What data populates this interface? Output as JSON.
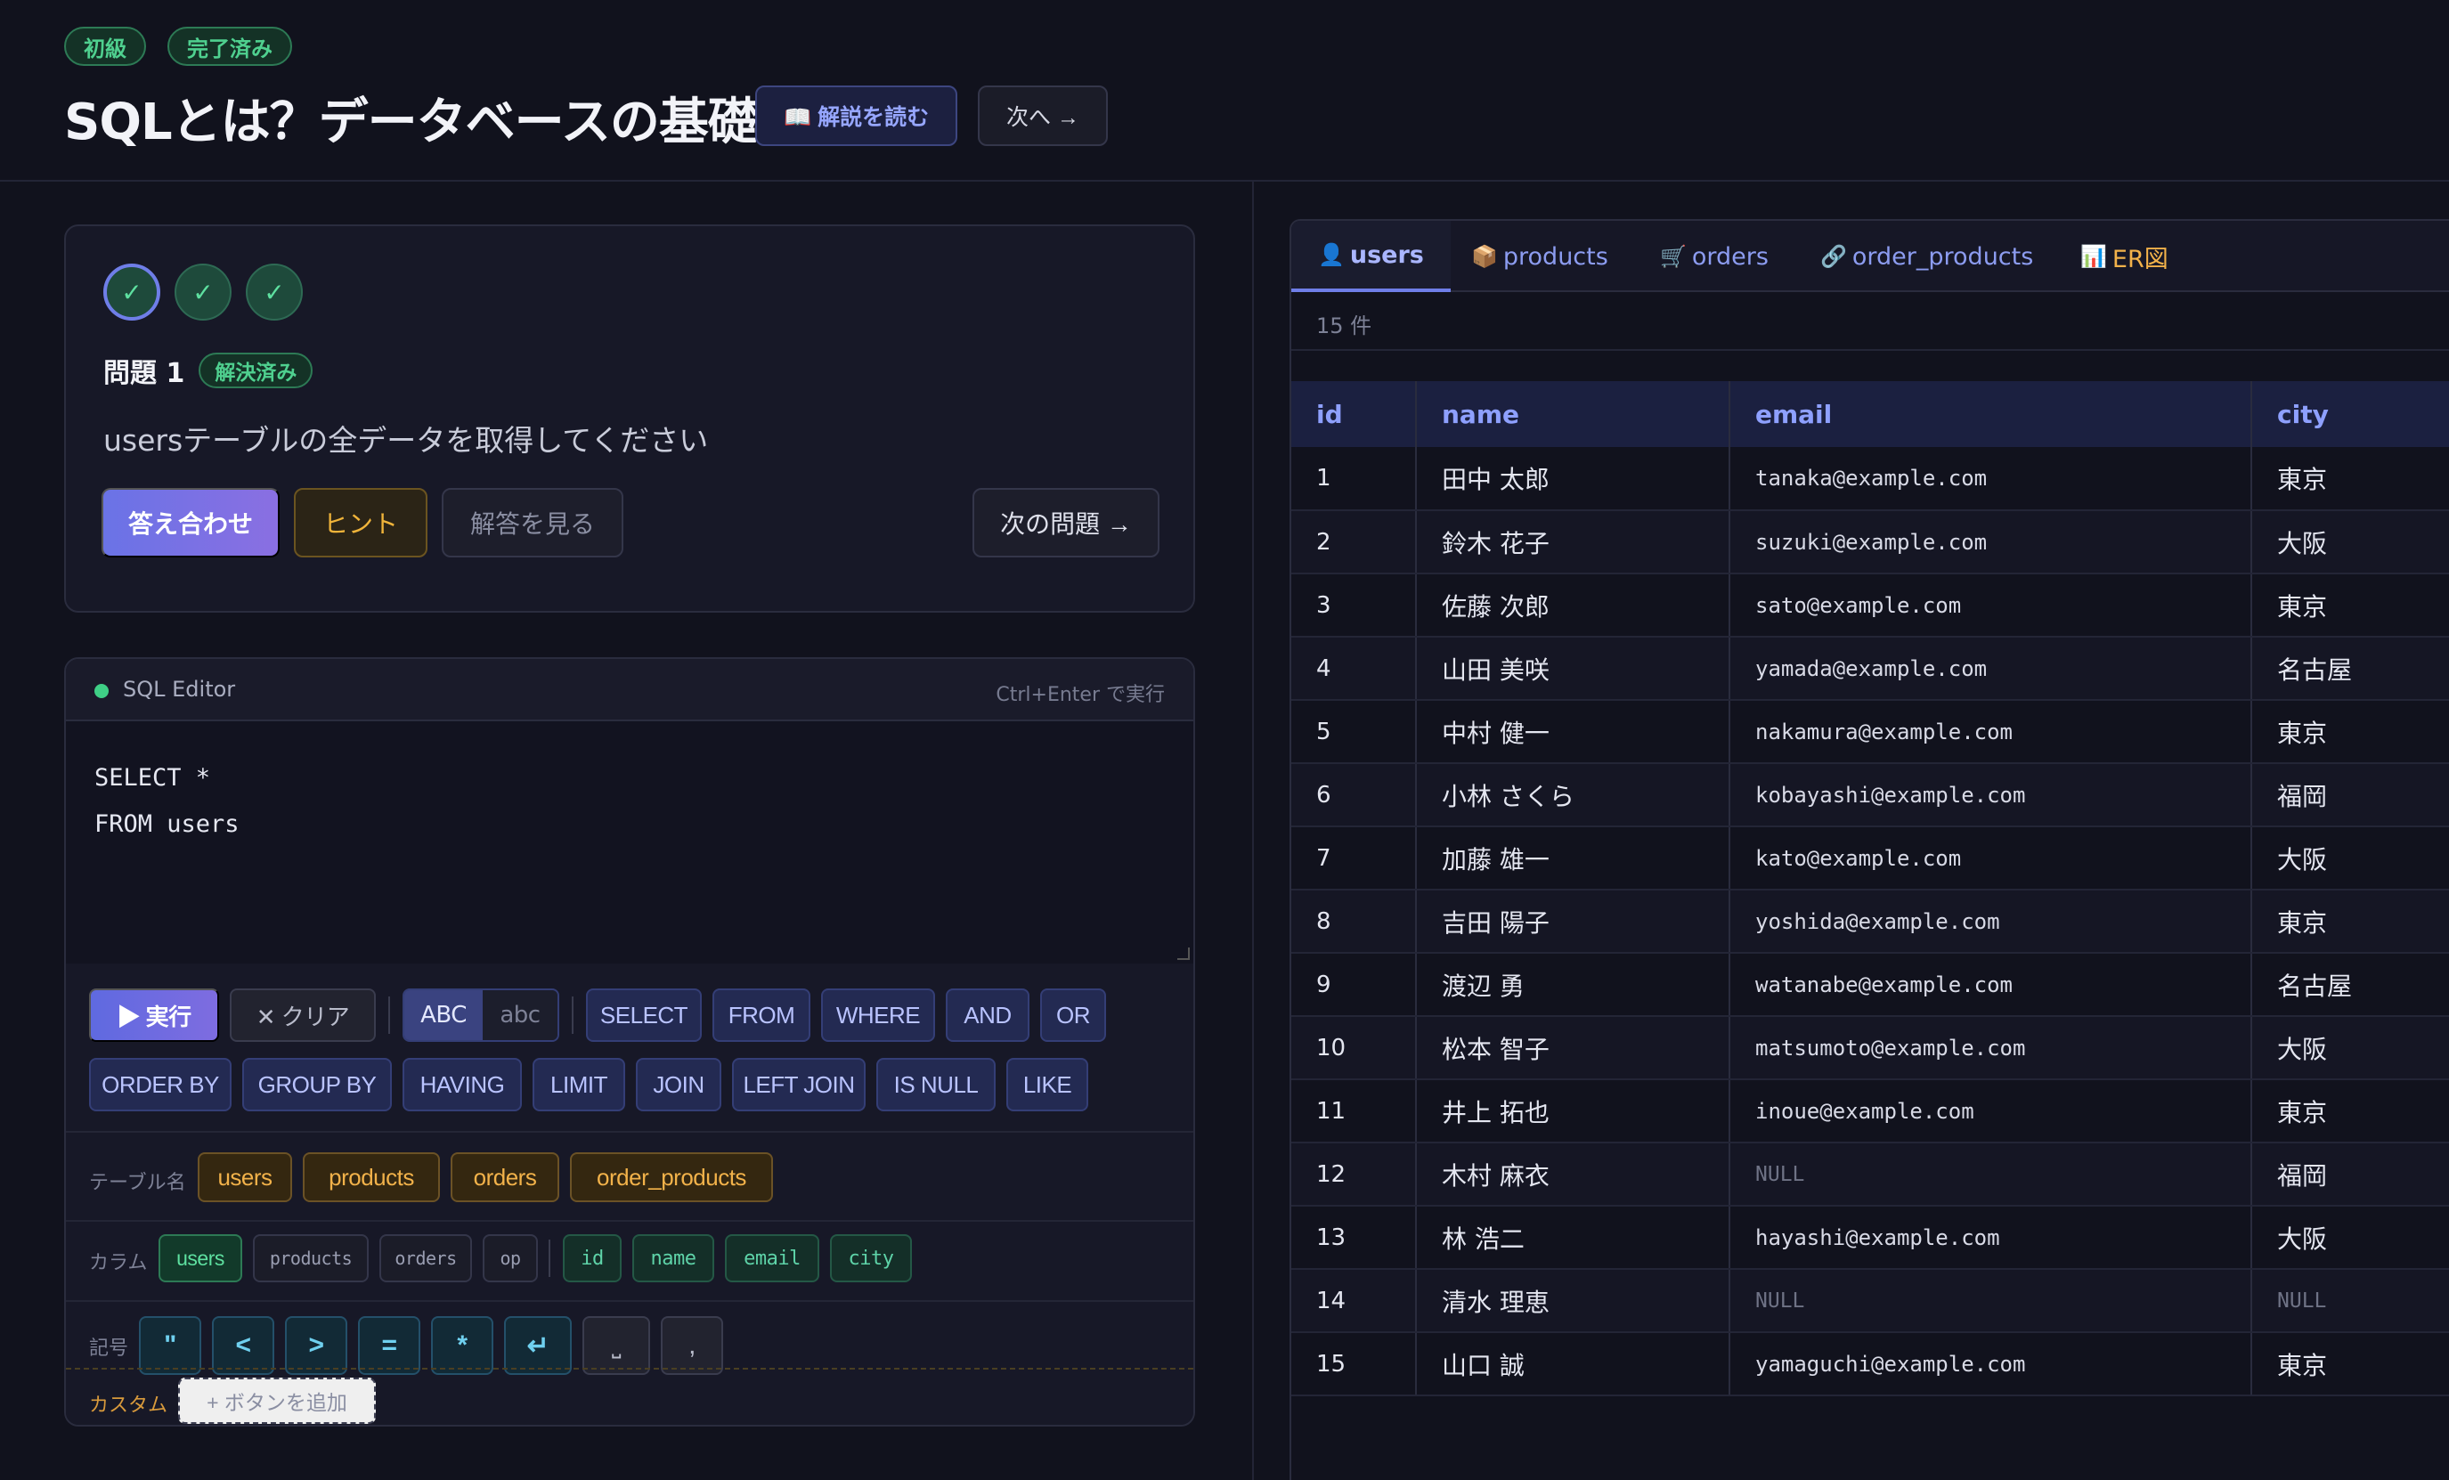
{
  "header": {
    "badges": [
      "初級",
      "完了済み"
    ],
    "title": "SQLとは？データベースの基礎",
    "read_button": "📖 解説を読む",
    "next_button": "次へ →"
  },
  "problem": {
    "steps": [
      "✓",
      "✓",
      "✓"
    ],
    "title": "問題 1",
    "status": "解決済み",
    "description": "usersテーブルの全データを取得してください",
    "buttons": {
      "check": "答え合わせ",
      "hint": "ヒント",
      "answer": "解答を見る",
      "next": "次の問題 →"
    }
  },
  "editor": {
    "title": "SQL Editor",
    "shortcut": "Ctrl+Enter で実行",
    "code_lines": [
      "SELECT *",
      "FROM users"
    ],
    "run": "▶ 実行",
    "clear": "✕ クリア",
    "case_upper": "ABC",
    "case_lower": "abc",
    "keywords_row1": [
      "SELECT",
      "FROM",
      "WHERE",
      "AND",
      "OR"
    ],
    "keywords_row2": [
      "ORDER BY",
      "GROUP BY",
      "HAVING",
      "LIMIT",
      "JOIN",
      "LEFT JOIN",
      "IS NULL",
      "LIKE"
    ],
    "table_label": "テーブル名",
    "tables": [
      "users",
      "products",
      "orders",
      "order_products"
    ],
    "column_label": "カラム",
    "column_tabs": [
      "users",
      "products",
      "orders",
      "op"
    ],
    "columns": [
      "id",
      "name",
      "email",
      "city"
    ],
    "symbol_label": "記号",
    "symbols": [
      "\"",
      "<",
      ">",
      "=",
      "*",
      "↵",
      "⎵",
      ","
    ],
    "custom_label": "カスタム",
    "custom_add": "+ ボタンを追加"
  },
  "tabs": [
    {
      "icon": "👤",
      "label": "users"
    },
    {
      "icon": "📦",
      "label": "products"
    },
    {
      "icon": "🛒",
      "label": "orders"
    },
    {
      "icon": "🔗",
      "label": "order_products"
    },
    {
      "icon": "📊",
      "label": "ER図"
    }
  ],
  "result": {
    "count": "15 件",
    "columns": [
      "id",
      "name",
      "email",
      "city"
    ],
    "rows": [
      [
        "1",
        "田中 太郎",
        "tanaka@example.com",
        "東京"
      ],
      [
        "2",
        "鈴木 花子",
        "suzuki@example.com",
        "大阪"
      ],
      [
        "3",
        "佐藤 次郎",
        "sato@example.com",
        "東京"
      ],
      [
        "4",
        "山田 美咲",
        "yamada@example.com",
        "名古屋"
      ],
      [
        "5",
        "中村 健一",
        "nakamura@example.com",
        "東京"
      ],
      [
        "6",
        "小林 さくら",
        "kobayashi@example.com",
        "福岡"
      ],
      [
        "7",
        "加藤 雄一",
        "kato@example.com",
        "大阪"
      ],
      [
        "8",
        "吉田 陽子",
        "yoshida@example.com",
        "東京"
      ],
      [
        "9",
        "渡辺 勇",
        "watanabe@example.com",
        "名古屋"
      ],
      [
        "10",
        "松本 智子",
        "matsumoto@example.com",
        "大阪"
      ],
      [
        "11",
        "井上 拓也",
        "inoue@example.com",
        "東京"
      ],
      [
        "12",
        "木村 麻衣",
        "NULL",
        "福岡"
      ],
      [
        "13",
        "林 浩二",
        "hayashi@example.com",
        "大阪"
      ],
      [
        "14",
        "清水 理恵",
        "NULL",
        "NULL"
      ],
      [
        "15",
        "山口 誠",
        "yamaguchi@example.com",
        "東京"
      ]
    ]
  }
}
